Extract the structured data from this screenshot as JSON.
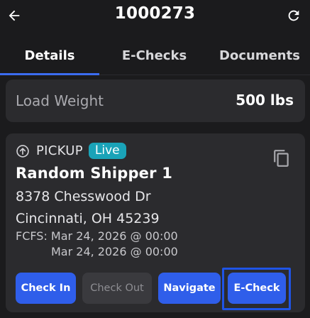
{
  "header": {
    "title": "1000273",
    "back_icon": "arrow-left-icon",
    "refresh_icon": "refresh-icon"
  },
  "tabs": [
    {
      "label": "Details",
      "active": true
    },
    {
      "label": "E-Checks",
      "active": false
    },
    {
      "label": "Documents",
      "active": false
    }
  ],
  "load": {
    "weight_label": "Load Weight",
    "weight_value": "500 lbs"
  },
  "stop": {
    "type_label": "PICKUP",
    "status_badge": "Live",
    "shipper_name": "Random Shipper 1",
    "address_line1": "8378 Chesswood Dr",
    "address_line2": "Cincinnati, OH 45239",
    "fcfs_line1": "FCFS: Mar 24, 2026 @ 00:00",
    "fcfs_line2": "Mar 24, 2026 @ 00:00",
    "buttons": {
      "check_in": "Check In",
      "check_out": "Check Out",
      "navigate": "Navigate",
      "e_check": "E-Check"
    }
  },
  "colors": {
    "background": "#1b1b1d",
    "card": "#2b2b2e",
    "accent": "#2f5eea",
    "live_badge": "#1aa3b8",
    "disabled_button": "#3a3a3e"
  }
}
